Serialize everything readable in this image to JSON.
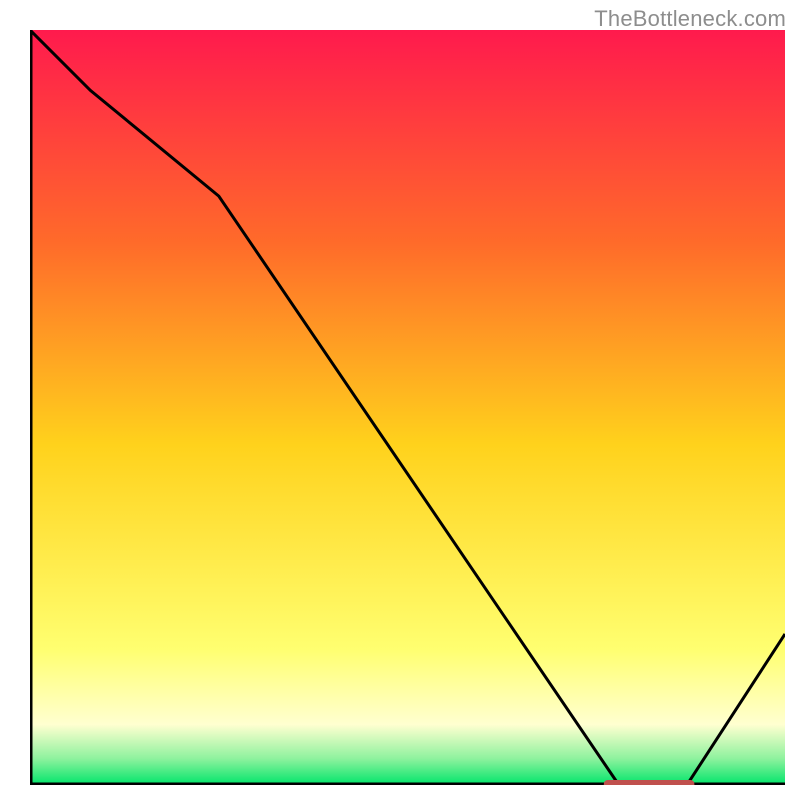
{
  "watermark": "TheBottleneck.com",
  "colors": {
    "gradient_top": "#ff1a4d",
    "gradient_upper": "#ff6a2a",
    "gradient_mid": "#ffd21c",
    "gradient_low": "#ffff70",
    "gradient_pale": "#ffffd0",
    "gradient_green_light": "#8ef29e",
    "gradient_green": "#00e56a",
    "curve": "#000000",
    "marker": "#c0504d",
    "axis": "#000000"
  },
  "chart_data": {
    "type": "line",
    "title": "",
    "xlabel": "",
    "ylabel": "",
    "xlim": [
      0,
      100
    ],
    "ylim": [
      0,
      100
    ],
    "series": [
      {
        "name": "curve",
        "x": [
          0,
          8,
          25,
          78,
          87,
          100
        ],
        "y": [
          100,
          92,
          78,
          0,
          0,
          20
        ]
      }
    ],
    "plateau_marker": {
      "x_start": 76,
      "x_end": 88,
      "y": 0
    },
    "gradient_stops": [
      {
        "offset": 0.0,
        "key": "gradient_top"
      },
      {
        "offset": 0.28,
        "key": "gradient_upper"
      },
      {
        "offset": 0.55,
        "key": "gradient_mid"
      },
      {
        "offset": 0.82,
        "key": "gradient_low"
      },
      {
        "offset": 0.92,
        "key": "gradient_pale"
      },
      {
        "offset": 0.965,
        "key": "gradient_green_light"
      },
      {
        "offset": 1.0,
        "key": "gradient_green"
      }
    ]
  }
}
